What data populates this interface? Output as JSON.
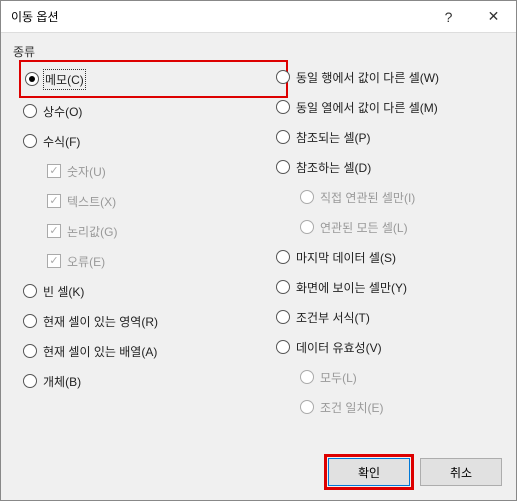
{
  "titlebar": {
    "title": "이동 옵션",
    "help": "?",
    "close": "✕"
  },
  "group_label": "종류",
  "left": {
    "memo": "메모(C)",
    "constants": "상수(O)",
    "formulas": "수식(F)",
    "numbers": "숫자(U)",
    "text": "텍스트(X)",
    "logicals": "논리값(G)",
    "errors": "오류(E)",
    "blanks": "빈 셀(K)",
    "current_region": "현재 셀이 있는 영역(R)",
    "current_array": "현재 셀이 있는 배열(A)",
    "objects": "개체(B)"
  },
  "right": {
    "row_diffs": "동일 행에서 값이 다른 셀(W)",
    "col_diffs": "동일 열에서 값이 다른 셀(M)",
    "precedents": "참조되는 셀(P)",
    "dependents": "참조하는 셀(D)",
    "direct_only": "직접 연관된 셀만(I)",
    "all_levels": "연관된 모든 셀(L)",
    "last_cell": "마지막 데이터 셀(S)",
    "visible_only": "화면에 보이는 셀만(Y)",
    "conditional_formats": "조건부 서식(T)",
    "data_validation": "데이터 유효성(V)",
    "all": "모두(L)",
    "same": "조건 일치(E)"
  },
  "footer": {
    "ok": "확인",
    "cancel": "취소"
  }
}
